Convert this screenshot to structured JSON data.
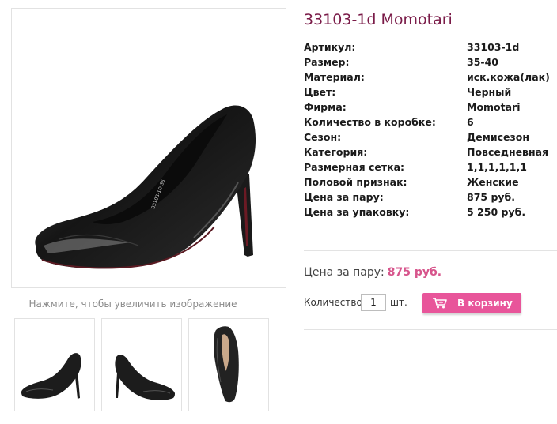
{
  "product": {
    "title": "33103-1d Momotari",
    "zoom_hint": "Нажмите, чтобы увеличить изображение"
  },
  "specs": [
    {
      "label": "Артикул:",
      "value": "33103-1d"
    },
    {
      "label": "Размер:",
      "value": "35-40"
    },
    {
      "label": "Материал:",
      "value": "иск.кожа(лак)"
    },
    {
      "label": "Цвет:",
      "value": "Черный"
    },
    {
      "label": "Фирма:",
      "value": "Momotari"
    },
    {
      "label": "Количество в коробке:",
      "value": "6"
    },
    {
      "label": "Сезон:",
      "value": "Демисезон"
    },
    {
      "label": "Категория:",
      "value": "Повседневная"
    },
    {
      "label": "Размерная сетка:",
      "value": "1,1,1,1,1,1"
    },
    {
      "label": "Половой признак:",
      "value": "Женские"
    },
    {
      "label": "Цена за пару:",
      "value": "875 руб."
    },
    {
      "label": "Цена за упаковку:",
      "value": "5 250 руб."
    }
  ],
  "price_block": {
    "label": "Цена за пару:",
    "price": "875 руб."
  },
  "order": {
    "qty_label": "Количество",
    "qty_value": "1",
    "unit": "шт.",
    "cart_button": "В корзину",
    "cart_icon": "shopping-cart-icon"
  },
  "colors": {
    "title": "#7a1b48",
    "price": "#d7558c",
    "button": "#e8559a"
  }
}
